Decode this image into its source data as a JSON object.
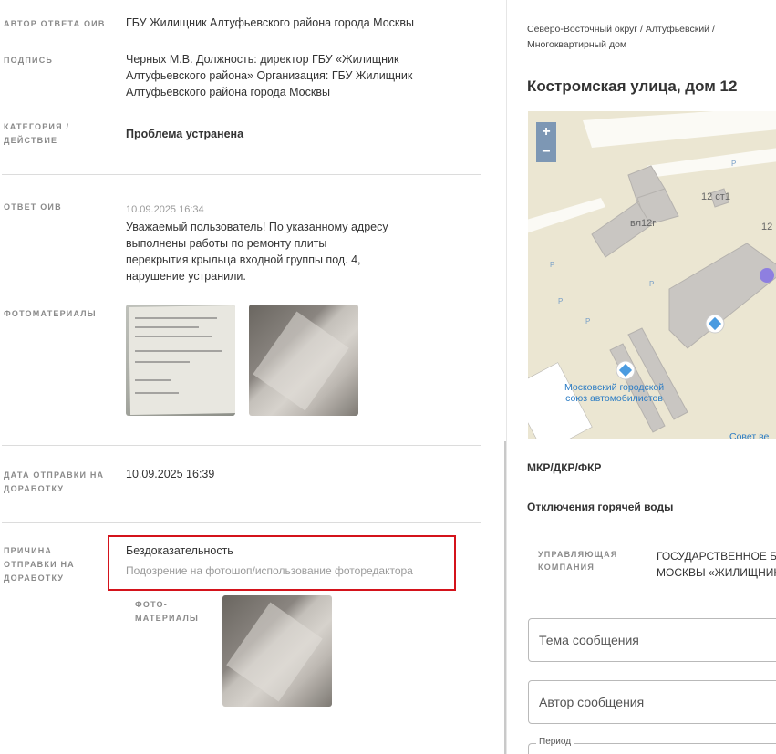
{
  "details": {
    "author_label": "АВТОР ОТВЕТА ОИВ",
    "author_value": "ГБУ Жилищник Алтуфьевского района города Москвы",
    "signature_label": "ПОДПИСЬ",
    "signature_value_1": "Черных М.В. Должность: директор ГБУ «Жилищник",
    "signature_value_2": "Алтуфьевского района» Организация: ГБУ Жилищник",
    "signature_value_3": "Алтуфьевского района города Москвы",
    "category_label_1": "КАТЕГОРИЯ /",
    "category_label_2": "ДЕЙСТВИЕ",
    "category_value": "Проблема устранена",
    "answer_label": "ОТВЕТ ОИВ",
    "answer_date": "10.09.2025 16:34",
    "answer_text_1": "Уважаемый пользователь! По указанному адресу",
    "answer_text_2": "выполнены работы по ремонту плиты",
    "answer_text_3": "перекрытия крыльца входной группы под. 4,",
    "answer_text_4": "нарушение устранили.",
    "photos_label": "ФОТОМАТЕРИАЛЫ",
    "sent_label_1": "ДАТА ОТПРАВКИ НА",
    "sent_label_2": "ДОРАБОТКУ",
    "sent_value": "10.09.2025 16:39",
    "reason_label_1": "ПРИЧИНА",
    "reason_label_2": "ОТПРАВКИ НА",
    "reason_label_3": "ДОРАБОТКУ",
    "reason_value": "Бездоказательность",
    "reason_comment": "Подозрение на фотошоп/использование фоторедактора",
    "photo_sub_label_1": "ФОТО-",
    "photo_sub_label_2": "МАТЕРИАЛЫ"
  },
  "object": {
    "breadcrumb_1": "Северо-Восточный округ / Алтуфьевский /",
    "breadcrumb_2": "Многоквартирный дом",
    "address": "Костромская улица, дом 12",
    "map": {
      "zoom_in": "+",
      "zoom_out": "−",
      "label_building_1": "вл12г",
      "label_building_2": "12 ст1",
      "label_building_3": "12",
      "poi_1": "Московский городской",
      "poi_2": "союз автомобилистов",
      "poi_3": "Совет ве",
      "parking": "P"
    },
    "program_label": "МКР/ДКР/ФКР",
    "hot_water_label": "Отключения горячей воды",
    "mgmt_label_1": "УПРАВЛЯЮЩАЯ",
    "mgmt_label_2": "КОМПАНИЯ",
    "mgmt_value_1": "ГОСУДАРСТВЕННОЕ БЮ",
    "mgmt_value_2": "МОСКВЫ «ЖИЛИЩНИК",
    "topic_placeholder": "Тема сообщения",
    "author_placeholder": "Автор сообщения",
    "period_label": "Период"
  },
  "colors": {
    "highlight": "#d4131b",
    "map_bg": "#ebe6d2",
    "zoom_btn": "#7d97b4",
    "poi_text": "#2b7cc4"
  }
}
